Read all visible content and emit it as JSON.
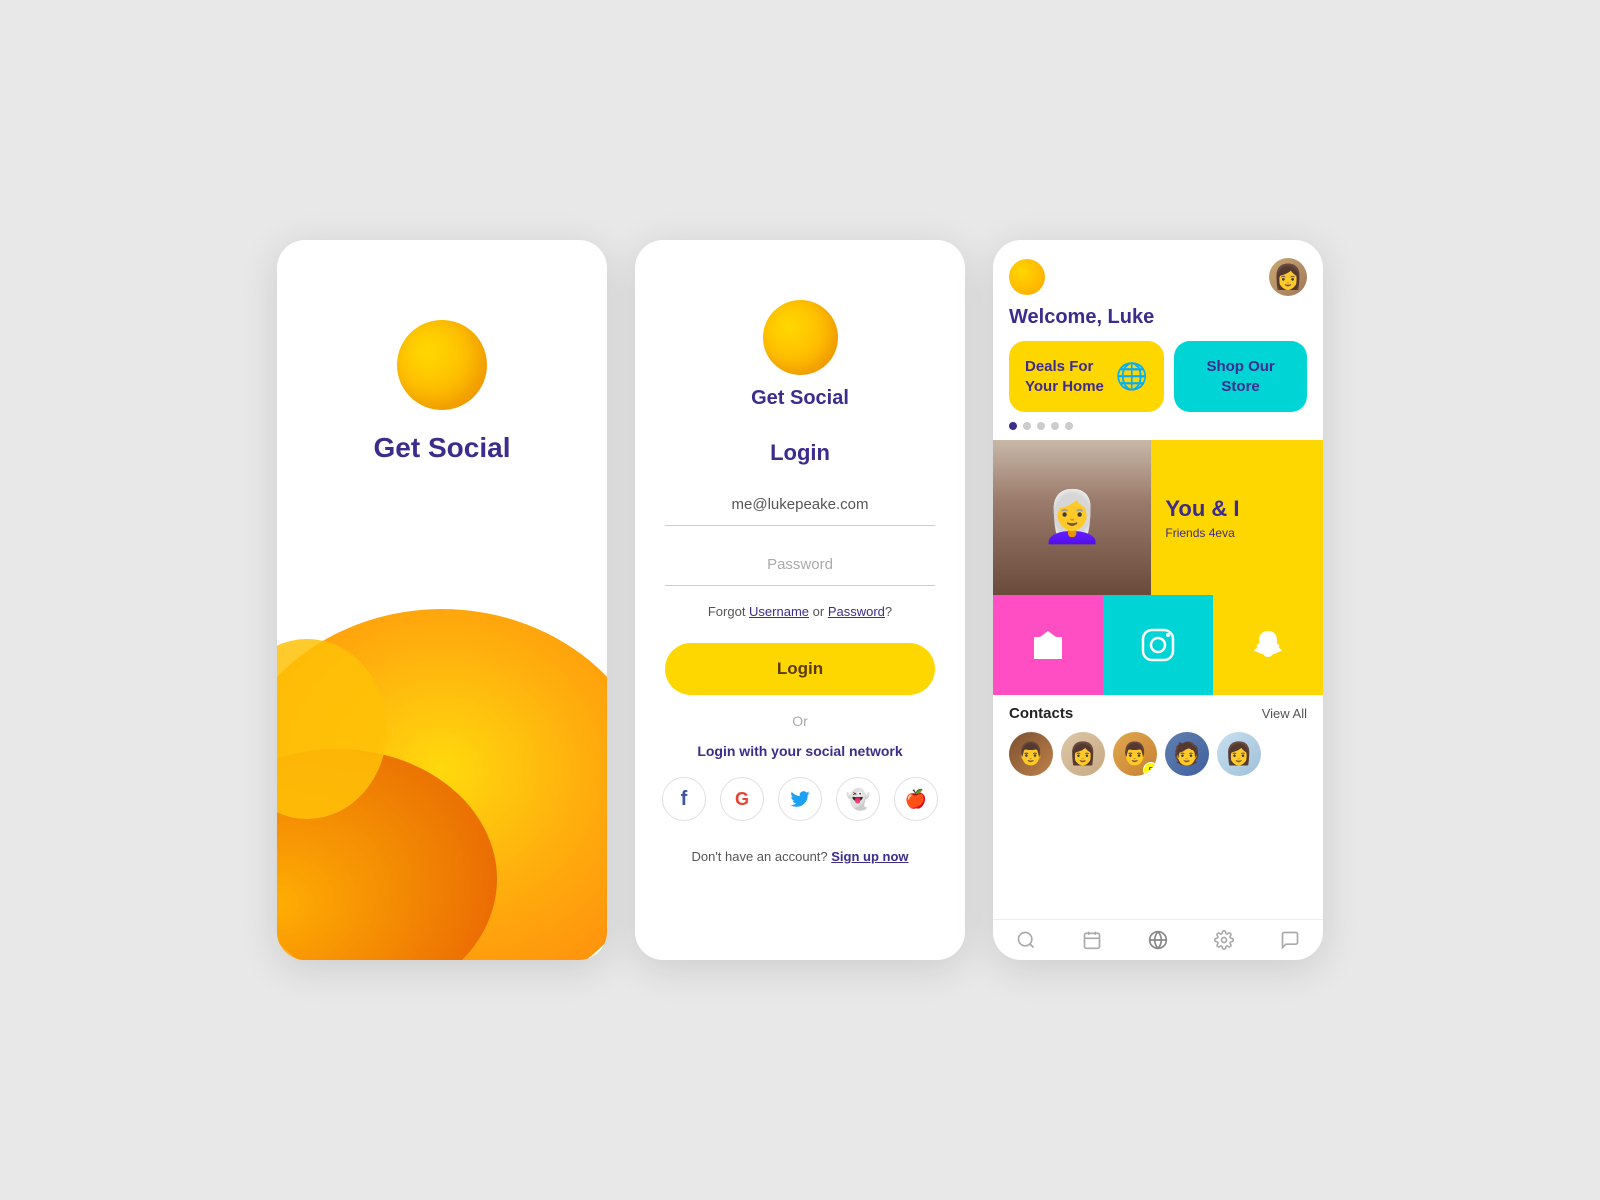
{
  "app": {
    "name": "Get Social",
    "accent_yellow": "#FFD700",
    "accent_purple": "#3d2c8d",
    "accent_cyan": "#00D4D4",
    "accent_pink": "#FF4EC4"
  },
  "screen1": {
    "title": "Get Social"
  },
  "screen2": {
    "app_title": "Get Social",
    "login_heading": "Login",
    "email_value": "me@lukepeake.com",
    "password_placeholder": "Password",
    "forgot_text": "Forgot ",
    "forgot_username": "Username",
    "forgot_or": " or ",
    "forgot_password": "Password",
    "forgot_end": "?",
    "login_btn": "Login",
    "or_text": "Or",
    "social_network_label": "Login with your social network",
    "signup_text": "Don't have an account? ",
    "signup_link": "Sign up now"
  },
  "screen3": {
    "welcome": "Welcome, Luke",
    "card1_line1": "Deals For",
    "card1_line2": "Your Home",
    "card2_line1": "Shop Our",
    "card2_line2": "Store",
    "promo_title": "You & I",
    "promo_sub": "Friends 4eva",
    "contacts_title": "Contacts",
    "view_all": "View All",
    "dots": [
      true,
      false,
      false,
      false,
      false
    ]
  },
  "social_icons": [
    {
      "name": "facebook-icon",
      "symbol": "f",
      "color": "#3b5998"
    },
    {
      "name": "google-icon",
      "symbol": "G",
      "color": "#EA4335"
    },
    {
      "name": "twitter-icon",
      "symbol": "🐦",
      "color": "#1DA1F2"
    },
    {
      "name": "snapchat-icon",
      "symbol": "👻",
      "color": "#FFFC00"
    },
    {
      "name": "apple-icon",
      "symbol": "🍎",
      "color": "#000"
    }
  ],
  "contacts": [
    {
      "id": "c1",
      "emoji": "👨"
    },
    {
      "id": "c2",
      "emoji": "👩"
    },
    {
      "id": "c3",
      "emoji": "👨‍🦱"
    },
    {
      "id": "c4",
      "emoji": "🧑"
    },
    {
      "id": "c5",
      "emoji": "👩‍🦱"
    }
  ],
  "bottom_nav": [
    {
      "name": "search-nav",
      "icon": "🔍"
    },
    {
      "name": "calendar-nav",
      "icon": "📅"
    },
    {
      "name": "globe-nav",
      "icon": "🌐"
    },
    {
      "name": "settings-nav",
      "icon": "⚙️"
    },
    {
      "name": "chat-nav",
      "icon": "💬"
    }
  ]
}
